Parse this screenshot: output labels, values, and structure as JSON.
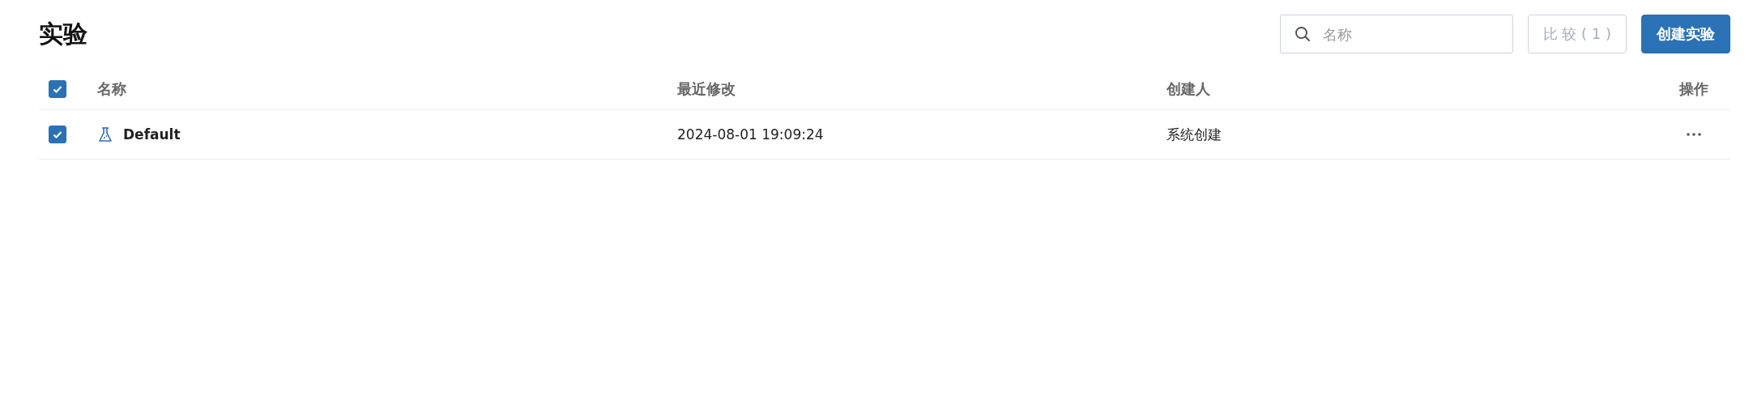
{
  "page": {
    "title": "实验"
  },
  "search": {
    "placeholder": "名称"
  },
  "buttons": [
    {
      "kind": "compare",
      "label": "比 较 ( 1 )",
      "disabled": true
    },
    {
      "kind": "create",
      "label": "创建实验",
      "disabled": false
    }
  ],
  "table": {
    "select_all": {
      "checked": true
    },
    "columns": [
      "名称",
      "最近修改",
      "创建人",
      "操作"
    ],
    "rows": [
      {
        "checked": true,
        "name": "Default",
        "modified": "2024-08-01 19:09:24",
        "creator": "系统创建"
      }
    ]
  }
}
